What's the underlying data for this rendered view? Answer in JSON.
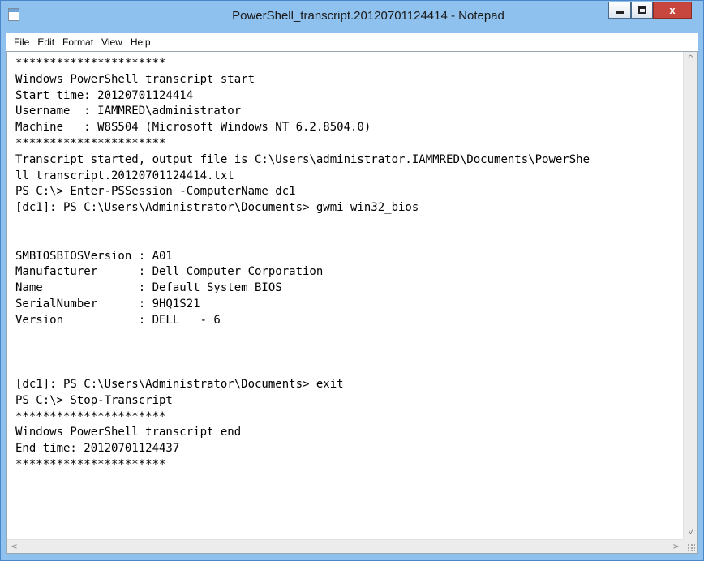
{
  "window": {
    "title": "PowerShell_transcript.20120701124414 - Notepad",
    "icon": "notepad-icon",
    "controls": {
      "minimize": "minimize-icon",
      "maximize": "maximize-icon",
      "close": "x"
    }
  },
  "menu": {
    "items": [
      "File",
      "Edit",
      "Format",
      "View",
      "Help"
    ]
  },
  "document": {
    "lines": [
      "**********************",
      "Windows PowerShell transcript start",
      "Start time: 20120701124414",
      "Username  : IAMMRED\\administrator",
      "Machine   : W8S504 (Microsoft Windows NT 6.2.8504.0)",
      "**********************",
      "Transcript started, output file is C:\\Users\\administrator.IAMMRED\\Documents\\PowerShe",
      "ll_transcript.20120701124414.txt",
      "PS C:\\> Enter-PSSession -ComputerName dc1",
      "[dc1]: PS C:\\Users\\Administrator\\Documents> gwmi win32_bios",
      "",
      "",
      "SMBIOSBIOSVersion : A01",
      "Manufacturer      : Dell Computer Corporation",
      "Name              : Default System BIOS",
      "SerialNumber      : 9HQ1S21",
      "Version           : DELL   - 6",
      "",
      "",
      "",
      "[dc1]: PS C:\\Users\\Administrator\\Documents> exit",
      "PS C:\\> Stop-Transcript",
      "**********************",
      "Windows PowerShell transcript end",
      "End time: 20120701124437",
      "**********************"
    ]
  },
  "scrollbars": {
    "up": "^",
    "down": "v",
    "left": "<",
    "right": ">"
  }
}
